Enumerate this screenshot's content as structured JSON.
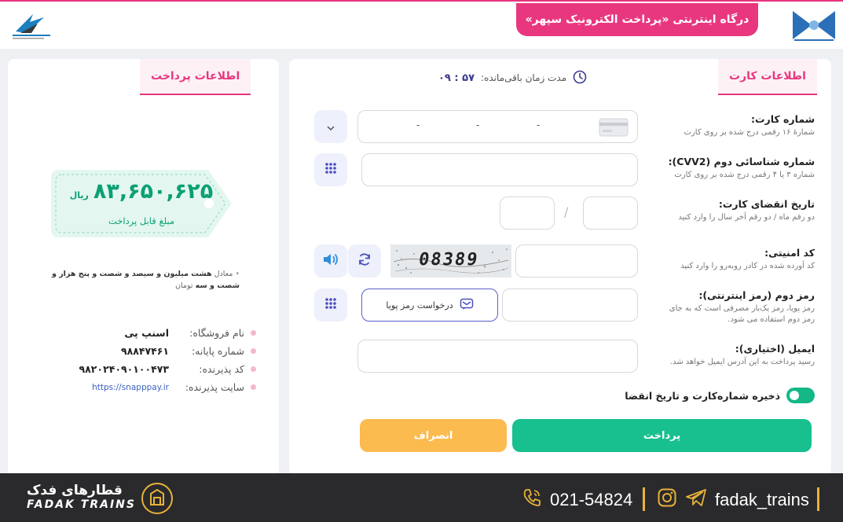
{
  "header": {
    "title": "درگاه اینترنتی «پرداخت الکترونیک سپهر»"
  },
  "card": {
    "tab_title": "اطلاعات کارت",
    "timer_label": "مدت زمان باقی‌مانده:",
    "timer_value": "۵۷ : ۰۹",
    "card_number": {
      "label": "شماره کارت:",
      "hint": "شمارهٔ ۱۶ رقمی درج شده بر روی کارت",
      "separators": [
        "-",
        "-",
        "-"
      ]
    },
    "cvv2": {
      "label": "شماره شناسائی دوم (CVV2):",
      "hint": "شماره ۳ یا ۴ رقمی درج شده بر روی کارت"
    },
    "expiry": {
      "label": "تاریخ انقضای کارت:",
      "hint": "دو رقم ماه / دو رقم آخر سال را وارد کنید",
      "separator": "/"
    },
    "captcha": {
      "label": "کد امنیتی:",
      "hint": "کد آورده شده در کادر روبه‌رو را وارد کنید",
      "image_text": "08389"
    },
    "pin2": {
      "label": "رمز دوم (رمز اینترنتی):",
      "hint": "رمز پویا، رمز یک‌بار مصرفی است که به جای رمز دوم استفاده می شود.",
      "otp_button": "درخواست رمز پویا"
    },
    "email": {
      "label": "ایمیل (اختیاری):",
      "hint": "رسید پرداخت به این آدرس ایمیل خواهد شد."
    },
    "save_toggle": "ذخیره شماره‌کارت و تاریخ انقضا",
    "pay_button": "پرداخت",
    "cancel_button": "انصراف"
  },
  "payment": {
    "tab_title": "اطلاعات پرداخت",
    "amount": "۸۳,۶۵۰,۶۲۵",
    "currency": "ریال",
    "amount_caption": "مبلغ قابل پرداخت",
    "words_prefix": "معادل",
    "words_text": "هشت میلیون و سیصد و شصت و پنج هزار و شصت و سه",
    "words_unit": "تومان",
    "info": [
      {
        "key": "نام فروشگاه:",
        "value": "اسنپ پی"
      },
      {
        "key": "شماره پایانه:",
        "value": "۹۸۸۴۷۴۶۱"
      },
      {
        "key": "کد پذیرنده:",
        "value": "۹۸۲۰۲۴۰۹۰۱۰۰۴۷۳"
      },
      {
        "key": "سایت پذیرنده:",
        "value": "https://snapppay.ir"
      }
    ]
  },
  "footer": {
    "brand_fa": "قطارهای فدک",
    "brand_en": "FADAK TRAINS",
    "phone": "021-54824",
    "social": "fadak_trains"
  },
  "colors": {
    "accent": "#e8377f",
    "primary": "#17c08e",
    "warning": "#fbbb4f",
    "footer_bg": "#2a2a2c"
  }
}
